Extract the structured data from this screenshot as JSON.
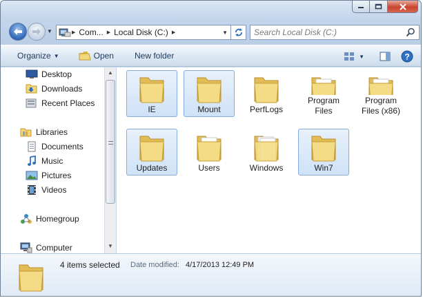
{
  "address": {
    "segments": [
      "Com...",
      "Local Disk (C:)"
    ]
  },
  "search": {
    "placeholder": "Search Local Disk (C:)"
  },
  "toolbar": {
    "organize_label": "Organize",
    "open_label": "Open",
    "new_folder_label": "New folder"
  },
  "nav_pane": {
    "favorites": [
      {
        "label": "Desktop",
        "icon": "desktop-icon"
      },
      {
        "label": "Downloads",
        "icon": "downloads-folder-icon"
      },
      {
        "label": "Recent Places",
        "icon": "recent-places-icon"
      }
    ],
    "libraries": {
      "label": "Libraries",
      "items": [
        {
          "label": "Documents",
          "icon": "documents-icon"
        },
        {
          "label": "Music",
          "icon": "music-icon"
        },
        {
          "label": "Pictures",
          "icon": "pictures-icon"
        },
        {
          "label": "Videos",
          "icon": "videos-icon"
        }
      ]
    },
    "homegroup": {
      "label": "Homegroup"
    },
    "computer": {
      "label": "Computer"
    }
  },
  "folders": [
    {
      "name": "IE",
      "selected": true
    },
    {
      "name": "Mount",
      "selected": true
    },
    {
      "name": "PerfLogs",
      "selected": false
    },
    {
      "name": "Program Files",
      "selected": false
    },
    {
      "name": "Program Files (x86)",
      "selected": false
    },
    {
      "name": "Updates",
      "selected": true
    },
    {
      "name": "Users",
      "selected": false
    },
    {
      "name": "Windows",
      "selected": false
    },
    {
      "name": "Win7",
      "selected": true
    }
  ],
  "folder_label_lines": [
    [
      "IE"
    ],
    [
      "Mount"
    ],
    [
      "PerfLogs"
    ],
    [
      "Program",
      "Files"
    ],
    [
      "Program",
      "Files (x86)"
    ],
    [
      "Updates"
    ],
    [
      "Users"
    ],
    [
      "Windows"
    ],
    [
      "Win7"
    ]
  ],
  "details": {
    "selection_text": "4 items selected",
    "modified_label": "Date modified:",
    "modified_value": "4/17/2013 12:49 PM"
  },
  "colors": {
    "selection_fill": "#cfe2f7",
    "selection_border": "#84acdd",
    "folder_yellow": "#f3d77b"
  }
}
